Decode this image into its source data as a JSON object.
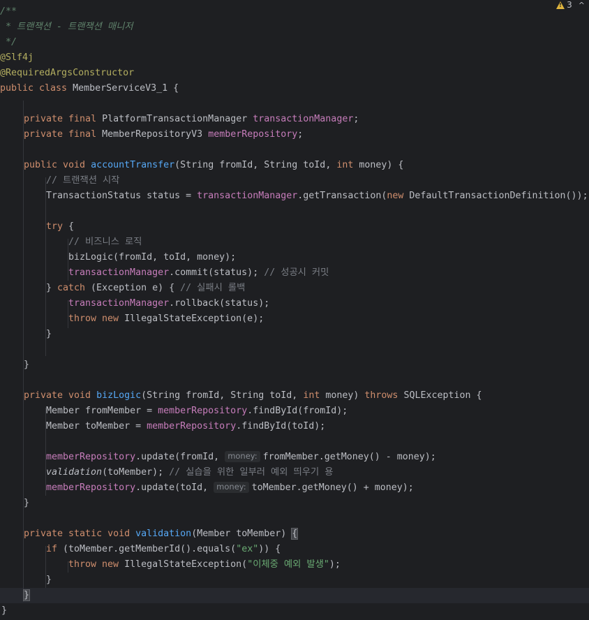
{
  "status_bar": {
    "warning_count": "3",
    "warning_icon": "warning-triangle-icon",
    "chevron_icon": "chevron-up-icon"
  },
  "code": {
    "l1": "/**",
    "l2": " * 트랜잭션 - 트랜잭션 매니저",
    "l3": " */",
    "l4": "@Slf4j",
    "l5": "@RequiredArgsConstructor",
    "l6_kw": "public class",
    "l6_rest": " MemberServiceV3_1 {",
    "l8_kw": "private final",
    "l8_type": " PlatformTransactionManager ",
    "l8_field": "transactionManager",
    "l8_end": ";",
    "l9_kw": "private final",
    "l9_type": " MemberRepositoryV3 ",
    "l9_field": "memberRepository",
    "l9_end": ";",
    "l11_kw": "public void",
    "l11_fn": "accountTransfer",
    "l11_a": "(String fromId, String toId, ",
    "l11_int": "int",
    "l11_b": " money) {",
    "l12": "// 트랜잭션 시작",
    "l13_a": "TransactionStatus status = ",
    "l13_field": "transactionManager",
    "l13_b": ".getTransaction(",
    "l13_new": "new",
    "l13_c": " DefaultTransactionDefinition());",
    "l15_kw": "try",
    "l15_b": " {",
    "l16": "// 비즈니스 로직",
    "l17": "bizLogic(fromId, toId, money);",
    "l18_field": "transactionManager",
    "l18_b": ".commit(status); ",
    "l18_cm": "// 성공시 커밋",
    "l19_a": "} ",
    "l19_kw": "catch",
    "l19_b": " (Exception e) { ",
    "l19_cm": "// 실패시 롤백",
    "l20_field": "transactionManager",
    "l20_b": ".rollback(status);",
    "l21_kw": "throw new",
    "l21_b": " IllegalStateException(e);",
    "l22": "}",
    "l24": "}",
    "l26_kw": "private void",
    "l26_fn": "bizLogic",
    "l26_a": "(String fromId, String toId, ",
    "l26_int": "int",
    "l26_b": " money) ",
    "l26_throws": "throws",
    "l26_c": " SQLException {",
    "l27_a": "Member fromMember = ",
    "l27_field": "memberRepository",
    "l27_b": ".findById(fromId);",
    "l28_a": "Member toMember = ",
    "l28_field": "memberRepository",
    "l28_b": ".findById(toId);",
    "l30_field": "memberRepository",
    "l30_a": ".update(fromId, ",
    "l30_hint": "money:",
    "l30_b": "fromMember.getMoney() - money);",
    "l31_fn": "validation",
    "l31_a": "(toMember); ",
    "l31_cm": "// 실습을 위한 일부러 예외 띄우기 용",
    "l32_field": "memberRepository",
    "l32_a": ".update(toId, ",
    "l32_hint": "money:",
    "l32_b": "toMember.getMoney() + money);",
    "l33": "}",
    "l35_kw": "private static void",
    "l35_fn": "validation",
    "l35_a": "(Member toMember) ",
    "l35_brace": "{",
    "l36_kw": "if",
    "l36_a": " (toMember.getMemberId().equals(",
    "l36_str": "\"ex\"",
    "l36_b": ")) {",
    "l37_kw": "throw new",
    "l37_a": " IllegalStateException(",
    "l37_str": "\"이체중 예외 발생\"",
    "l37_b": ");",
    "l38": "}",
    "l39": "}",
    "l40": "}"
  }
}
